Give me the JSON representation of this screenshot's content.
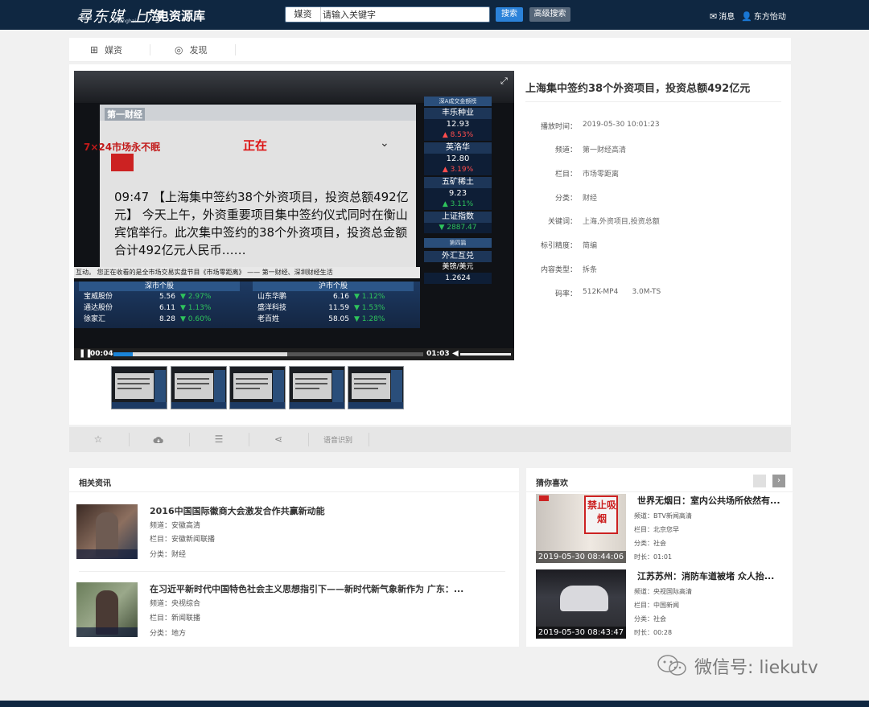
{
  "header": {
    "logo_text": "尋东媒 上海",
    "logo_sub": "Shanghai",
    "site_title": "广电资源库",
    "search_category": "媒资",
    "search_placeholder": "请输入关键字",
    "search_button": "搜索",
    "advanced_button": "高级搜索",
    "messages_label": "消息",
    "user_label": "东方怡动"
  },
  "tabs": [
    {
      "label": "媒资",
      "icon": "media-icon"
    },
    {
      "label": "发现",
      "icon": "compass-icon"
    }
  ],
  "player": {
    "current_time": "00:04",
    "duration": "01:03",
    "played_fraction": 0.063,
    "buffered_fraction": 0.56,
    "screen": {
      "brand": "第一财经",
      "live_title": "7×24市场永不眠",
      "live_badge": "正在",
      "news_text": "09:47 【上海集中签约38个外资项目，投资总额492亿元】 今天上午，外资重要项目集中签约仪式同时在衡山宾馆举行。此次集中签约的38个外资项目，投资总金额合计492亿元人民币……",
      "ticker": "互动。   您正在收看的是全市场交易实盘节目《市场零距离》 —— 第一财经、深圳财经生活",
      "side_header": "深A成交金额榜",
      "side_stocks": [
        {
          "name": "丰乐种业",
          "price": "12.93",
          "change": "▲ 8.53%",
          "dir": "up"
        },
        {
          "name": "英洛华",
          "price": "12.80",
          "change": "▲ 3.19%",
          "dir": "up"
        },
        {
          "name": "五矿稀土",
          "price": "9.23",
          "change": "▲ 3.11%",
          "dir": "dn"
        },
        {
          "name": "上证指数",
          "price": "▼ 2887.47",
          "change": "",
          "dir": "dn"
        }
      ],
      "fx": {
        "title": "外汇互兑",
        "pair": "美镑/美元",
        "value": "1.2624",
        "header": "第四篇"
      },
      "boards": [
        {
          "title": "深市个股",
          "rows": [
            {
              "name": "宝威股份",
              "price": "5.56",
              "change": "▼ 2.97%"
            },
            {
              "name": "通达股份",
              "price": "6.11",
              "change": "▼ 1.13%"
            },
            {
              "name": "徐家汇",
              "price": "8.28",
              "change": "▼ 0.60%"
            }
          ]
        },
        {
          "title": "沪市个股",
          "rows": [
            {
              "name": "山东华鹏",
              "price": "6.16",
              "change": "▼ 1.12%"
            },
            {
              "name": "盛洋科技",
              "price": "11.59",
              "change": "▼ 1.53%"
            },
            {
              "name": "老百姓",
              "price": "58.05",
              "change": "▼ 1.28%"
            }
          ]
        }
      ]
    },
    "thumb_count": 5
  },
  "detail": {
    "title": "上海集中签约38个外资项目，投资总额492亿元",
    "fields": [
      {
        "key": "播放时间：",
        "value": "2019-05-30 10:01:23"
      },
      {
        "key": "频道：",
        "value": "第一财经高清"
      },
      {
        "key": "栏目：",
        "value": "市场零距离"
      },
      {
        "key": "分类：",
        "value": "财经"
      },
      {
        "key": "关键词：",
        "value": "上海,外资项目,投资总额"
      },
      {
        "key": "标引精度：",
        "value": "简编"
      },
      {
        "key": "内容类型：",
        "value": "拆条"
      },
      {
        "key": "码率：",
        "value": "512K-MP4      3.0M-TS"
      }
    ]
  },
  "actions": {
    "favorite_icon": "star-icon",
    "download_icon": "cloud-download-icon",
    "list_icon": "list-icon",
    "share_icon": "share-icon",
    "speech_label": "语音识别"
  },
  "related": {
    "title": "相关资讯",
    "items": [
      {
        "title": "2016中国国际徽商大会激发合作共赢新动能",
        "channel": "频道：安徽高清",
        "column": "栏目：安徽新闻联播",
        "category": "分类：财经"
      },
      {
        "title": "在习近平新时代中国特色社会主义思想指引下——新时代新气象新作为 广东：...",
        "channel": "频道：央视综合",
        "column": "栏目：新闻联播",
        "category": "分类：地方"
      }
    ]
  },
  "recommend": {
    "title": "猜你喜欢",
    "items": [
      {
        "title": "世界无烟日：室内公共场所依然有...",
        "stamp": "2019-05-30 08:44:06",
        "sign_text": "禁止吸烟",
        "channel": "频道：BTV新闻高清",
        "column": "栏目：北京您早",
        "category": "分类：社会",
        "duration": "时长：01:01"
      },
      {
        "title": "江苏苏州：消防车道被堵 众人抬...",
        "stamp": "2019-05-30 08:43:47",
        "channel": "频道：央视国际高清",
        "column": "栏目：中国新闻",
        "category": "分类：社会",
        "duration": "时长：00:28"
      }
    ]
  },
  "watermark": "微信号: liekutv",
  "colors": {
    "topbar": "#0f2741",
    "accent": "#2b82d9",
    "up": "#ff4d4d",
    "down": "#2ec45c"
  }
}
